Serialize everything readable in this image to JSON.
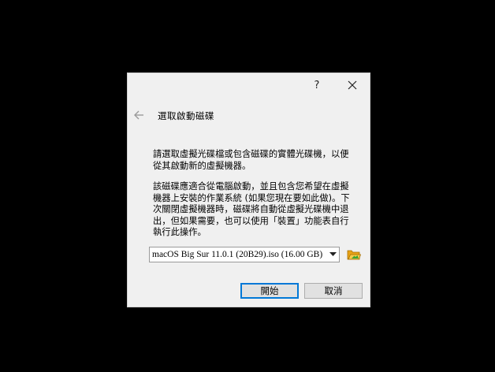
{
  "titlebar": {
    "help_label": "?",
    "close_icon": "close-icon"
  },
  "wizard": {
    "back_icon": "back-arrow-icon",
    "title": "選取啟動磁碟"
  },
  "body": {
    "paragraph1": "請選取虛擬光碟檔或包含磁碟的實體光碟機，以便從其啟動新的虛擬機器。",
    "paragraph2": "該磁碟應適合從電腦啟動，並且包含您希望在虛擬機器上安裝的作業系統 (如果您現在要如此做)。下次關閉虛擬機器時，磁碟將自動從虛擬光碟機中退出，但如果需要，也可以使用「裝置」功能表自行執行此操作。"
  },
  "disk_select": {
    "selected_value": "macOS Big Sur 11.0.1 (20B29).iso (16.00 GB)",
    "dropdown_icon": "chevron-down-icon",
    "browse_icon": "folder-open-icon"
  },
  "buttons": {
    "start_label": "開始",
    "cancel_label": "取消"
  },
  "colors": {
    "background": "#000000",
    "dialog": "#f0f0f0",
    "accent": "#0078d7"
  }
}
